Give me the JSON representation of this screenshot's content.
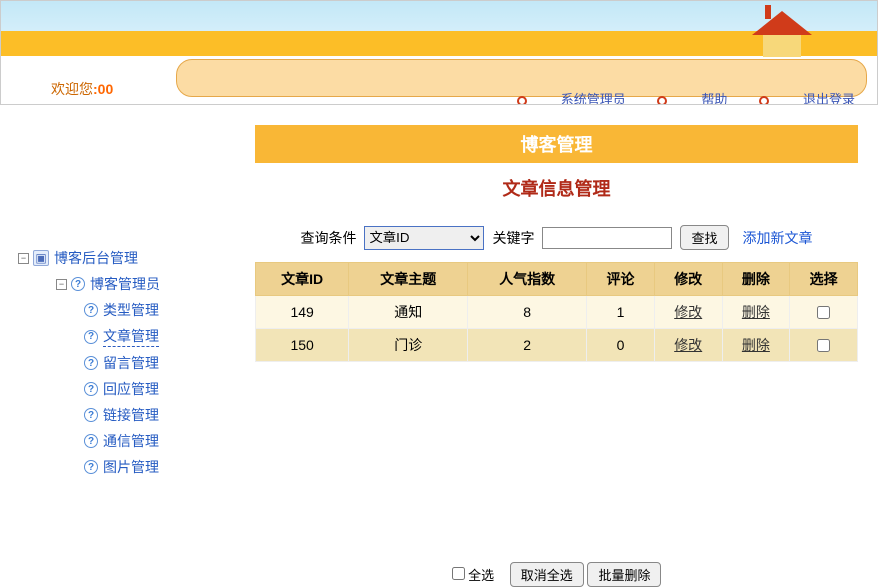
{
  "welcome_prefix": "欢迎您",
  "welcome_user": ":00",
  "topnav": {
    "admin": "系统管理员",
    "help": "帮助",
    "logout": "退出登录"
  },
  "sidebar": {
    "root": "博客后台管理",
    "admin": "博客管理员",
    "items": [
      "类型管理",
      "文章管理",
      "留言管理",
      "回应管理",
      "链接管理",
      "通信管理",
      "图片管理"
    ],
    "selected_index": 1
  },
  "page": {
    "title": "博客管理",
    "subtitle": "文章信息管理"
  },
  "search": {
    "condition_label": "查询条件",
    "select_value": "文章ID",
    "keyword_label": "关键字",
    "find_btn": "查找",
    "add_link": "添加新文章"
  },
  "table": {
    "headers": [
      "文章ID",
      "文章主题",
      "人气指数",
      "评论",
      "修改",
      "删除",
      "选择"
    ],
    "rows": [
      {
        "id": "149",
        "topic": "通知",
        "popularity": "8",
        "comments": "1"
      },
      {
        "id": "150",
        "topic": "门诊",
        "popularity": "2",
        "comments": "0"
      }
    ],
    "edit_label": "修改",
    "delete_label": "删除"
  },
  "footer": {
    "select_all": "全选",
    "cancel_all": "取消全选",
    "batch_delete": "批量删除"
  }
}
